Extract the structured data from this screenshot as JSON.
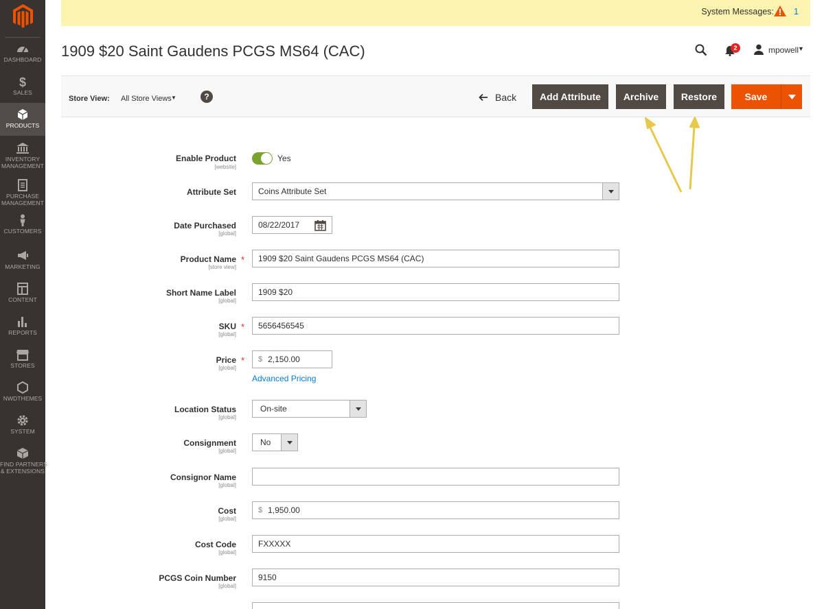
{
  "system": {
    "label": "System Messages:",
    "count": "1"
  },
  "page": {
    "title": "1909 $20 Saint Gaudens PCGS MS64 (CAC)"
  },
  "header": {
    "notifications_count": "2",
    "user": "mpowell"
  },
  "sidebar": {
    "items": [
      {
        "label": "DASHBOARD",
        "icon": "dashboard-icon"
      },
      {
        "label": "SALES",
        "icon": "dollar-icon"
      },
      {
        "label": "PRODUCTS",
        "icon": "cube-icon",
        "active": true
      },
      {
        "label": "INVENTORY MANAGEMENT",
        "line1": "INVENTORY",
        "line2": "MANAGEMENT",
        "icon": "bank-icon"
      },
      {
        "label": "PURCHASE MANAGEMENT",
        "line1": "PURCHASE",
        "line2": "MANAGEMENT",
        "icon": "document-icon"
      },
      {
        "label": "CUSTOMERS",
        "icon": "person-icon"
      },
      {
        "label": "MARKETING",
        "icon": "megaphone-icon"
      },
      {
        "label": "CONTENT",
        "icon": "layout-icon"
      },
      {
        "label": "REPORTS",
        "icon": "bar-chart-icon"
      },
      {
        "label": "STORES",
        "icon": "storefront-icon"
      },
      {
        "label": "NWDTHEMES",
        "icon": "hexagon-icon"
      },
      {
        "label": "SYSTEM",
        "icon": "gear-icon"
      },
      {
        "label": "FIND PARTNERS & EXTENSIONS",
        "line1": "FIND PARTNERS",
        "line2": "& EXTENSIONS",
        "icon": "box-icon"
      }
    ]
  },
  "toolbar": {
    "store_view_label": "Store View:",
    "store_view_value": "All Store Views",
    "help": "?",
    "back": "Back",
    "add_attribute": "Add Attribute",
    "archive": "Archive",
    "restore": "Restore",
    "save": "Save"
  },
  "form": {
    "enable_product": {
      "label": "Enable Product",
      "scope": "[website]",
      "value": "Yes",
      "enabled": true
    },
    "attribute_set": {
      "label": "Attribute Set",
      "value": "Coins Attribute Set"
    },
    "date_purchased": {
      "label": "Date Purchased",
      "scope": "[global]",
      "value": "08/22/2017"
    },
    "product_name": {
      "label": "Product Name",
      "scope": "[store view]",
      "value": "1909 $20 Saint Gaudens PCGS MS64 (CAC)",
      "required": true
    },
    "short_name": {
      "label": "Short Name Label",
      "scope": "[global]",
      "value": "1909 $20"
    },
    "sku": {
      "label": "SKU",
      "scope": "[global]",
      "value": "5656456545",
      "required": true
    },
    "price": {
      "label": "Price",
      "scope": "[global]",
      "prefix": "$",
      "value": "2,150.00",
      "required": true,
      "advanced_link": "Advanced Pricing"
    },
    "location_status": {
      "label": "Location Status",
      "scope": "[global]",
      "value": "On-site"
    },
    "consignment": {
      "label": "Consignment",
      "scope": "[global]",
      "value": "No"
    },
    "consignor_name": {
      "label": "Consignor Name",
      "scope": "[global]",
      "value": ""
    },
    "cost": {
      "label": "Cost",
      "scope": "[global]",
      "prefix": "$",
      "value": "1,950.00"
    },
    "cost_code": {
      "label": "Cost Code",
      "scope": "[global]",
      "value": "FXXXXX"
    },
    "pcgs_coin_number": {
      "label": "PCGS Coin Number",
      "scope": "[global]",
      "value": "9150"
    }
  },
  "colors": {
    "accent": "#eb5202",
    "dark_button": "#514943",
    "sidebar": "#373330",
    "notice": "#fcf4b0",
    "annotation": "#e8c84a"
  }
}
